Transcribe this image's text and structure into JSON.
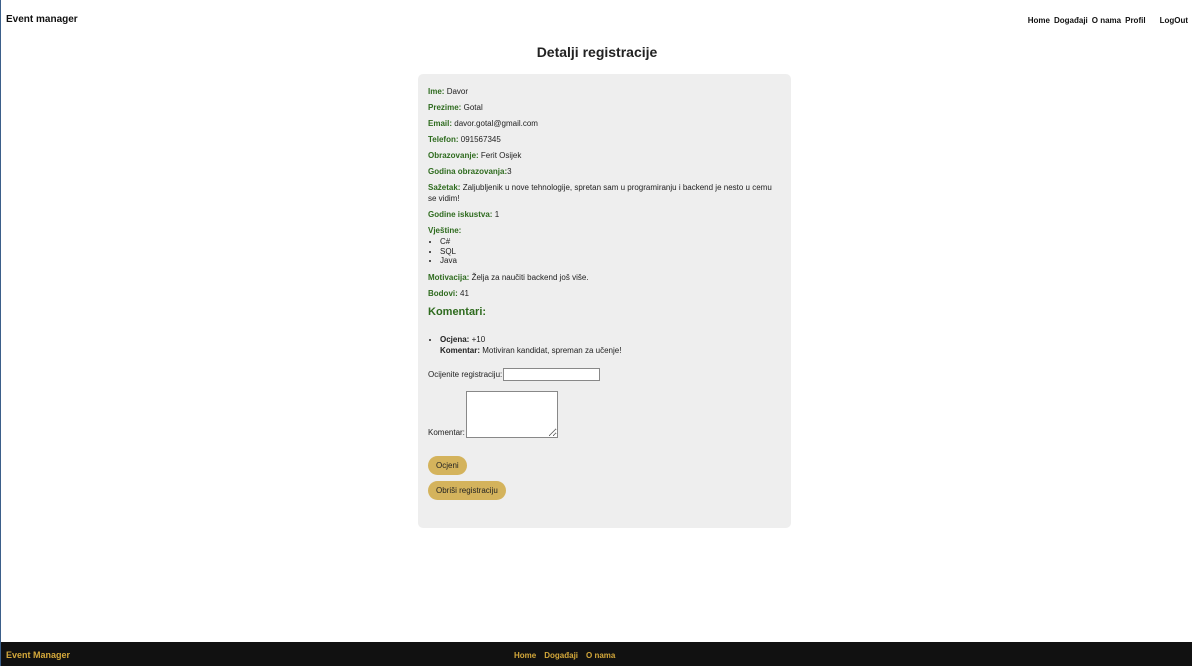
{
  "header": {
    "brand": "Event manager",
    "nav": [
      "Home",
      "Događaji",
      "O nama",
      "Profil"
    ],
    "logout": "LogOut"
  },
  "page_title": "Detalji registracije",
  "details": {
    "ime": {
      "label": "Ime:",
      "value": "Davor"
    },
    "prezime": {
      "label": "Prezime:",
      "value": "Gotal"
    },
    "email": {
      "label": "Email:",
      "value": "davor.gotal@gmail.com"
    },
    "telefon": {
      "label": "Telefon:",
      "value": "091567345"
    },
    "obrazovanje": {
      "label": "Obrazovanje:",
      "value": "Ferit Osijek"
    },
    "godina_obrazovanja": {
      "label": "Godina obrazovanja:",
      "value": "3"
    },
    "sazetak": {
      "label": "Sažetak:",
      "value": "Zaljubljenik u nove tehnologije, spretan sam u programiranju i backend je nesto u cemu se vidim!"
    },
    "godine_iskustva": {
      "label": "Godine iskustva:",
      "value": "1"
    },
    "vjestine": {
      "label": "Vještine:",
      "items": [
        "C#",
        "SQL",
        "Java"
      ]
    },
    "motivacija": {
      "label": "Motivacija:",
      "value": "Želja za naučiti backend još više."
    },
    "bodovi": {
      "label": "Bodovi:",
      "value": "41"
    }
  },
  "comments": {
    "heading": "Komentari:",
    "items": [
      {
        "ocjena_label": "Ocjena:",
        "ocjena": "+10",
        "komentar_label": "Komentar:",
        "komentar": "Motiviran kandidat, spreman za učenje!"
      }
    ]
  },
  "form": {
    "rate_label": "Ocijenite registraciju:",
    "rate_value": "",
    "comment_label": "Komentar:",
    "comment_value": "",
    "submit_label": "Ocjeni",
    "delete_label": "Obriši registraciju"
  },
  "footer": {
    "brand": "Event Manager",
    "nav": [
      "Home",
      "Događaji",
      "O nama"
    ]
  },
  "colors": {
    "label_green": "#2e6b1e",
    "button_gold": "#d4b35c",
    "footer_bg": "#111111",
    "footer_text": "#d4a83a",
    "card_bg": "#eeeeee"
  }
}
